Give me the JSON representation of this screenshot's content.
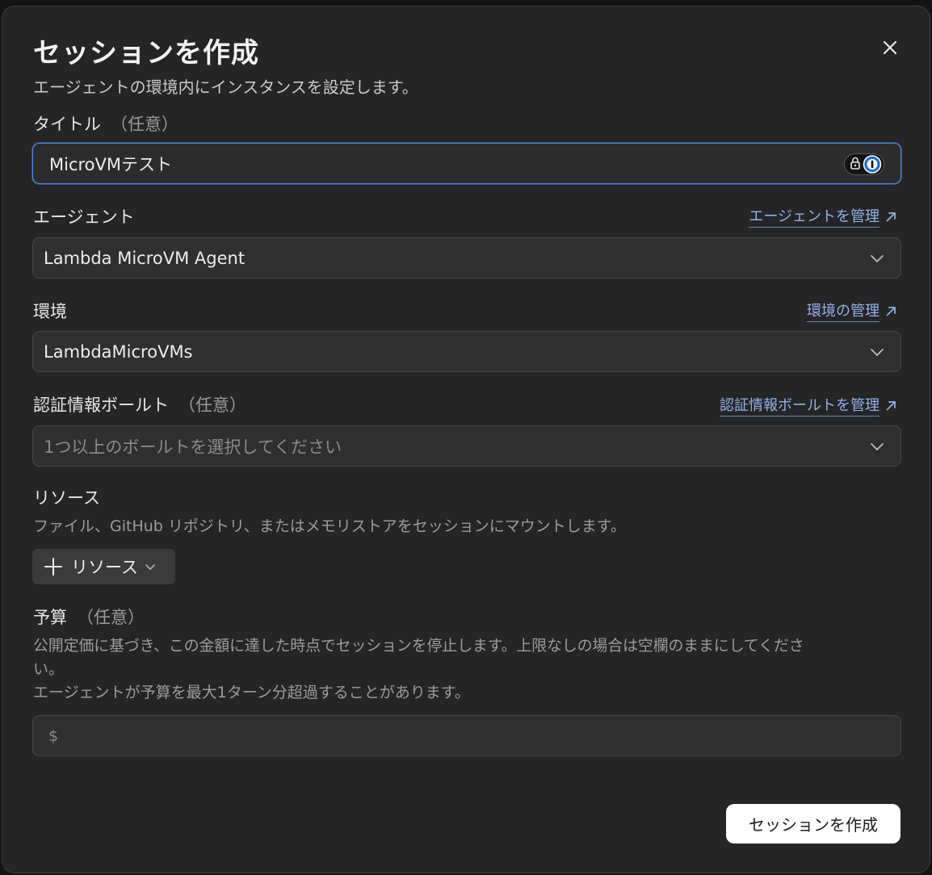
{
  "dialog": {
    "title": "セッションを作成",
    "subtitle": "エージェントの環境内にインスタンスを設定します。"
  },
  "title_field": {
    "label": "タイトル",
    "optional": "（任意）",
    "value": "MicroVMテスト"
  },
  "agent": {
    "label": "エージェント",
    "manage_link": "エージェントを管理",
    "selected": "Lambda MicroVM Agent"
  },
  "environment": {
    "label": "環境",
    "manage_link": "環境の管理",
    "selected": "LambdaMicroVMs"
  },
  "vault": {
    "label": "認証情報ボールト",
    "optional": "（任意）",
    "manage_link": "認証情報ボールトを管理",
    "placeholder": "1つ以上のボールトを選択してください"
  },
  "resources": {
    "label": "リソース",
    "description": "ファイル、GitHub リポジトリ、またはメモリストアをセッションにマウントします。",
    "add_button": "リソース"
  },
  "budget": {
    "label": "予算",
    "optional": "（任意）",
    "description_line1": "公開定価に基づき、この金額に達した時点でセッションを停止します。上限なしの場合は空欄のままにしてくださ",
    "description_line2": "い。",
    "description_line3": "エージェントが予算を最大1ターン分超過することがあります。",
    "currency_symbol": "$",
    "value": ""
  },
  "footer": {
    "submit_label": "セッションを作成"
  },
  "icons": {
    "close": "close-icon",
    "external_link": "arrow-up-right-icon",
    "dropdown": "chevron-down-icon",
    "password_manager": "password-manager-icon",
    "add": "plus-icon"
  },
  "colors": {
    "dialog_bg": "#252525",
    "field_bg": "#2f2f2f",
    "link": "#8fb2ec",
    "focus_ring": "#4a89e8",
    "primary_button": "#ffffff"
  }
}
